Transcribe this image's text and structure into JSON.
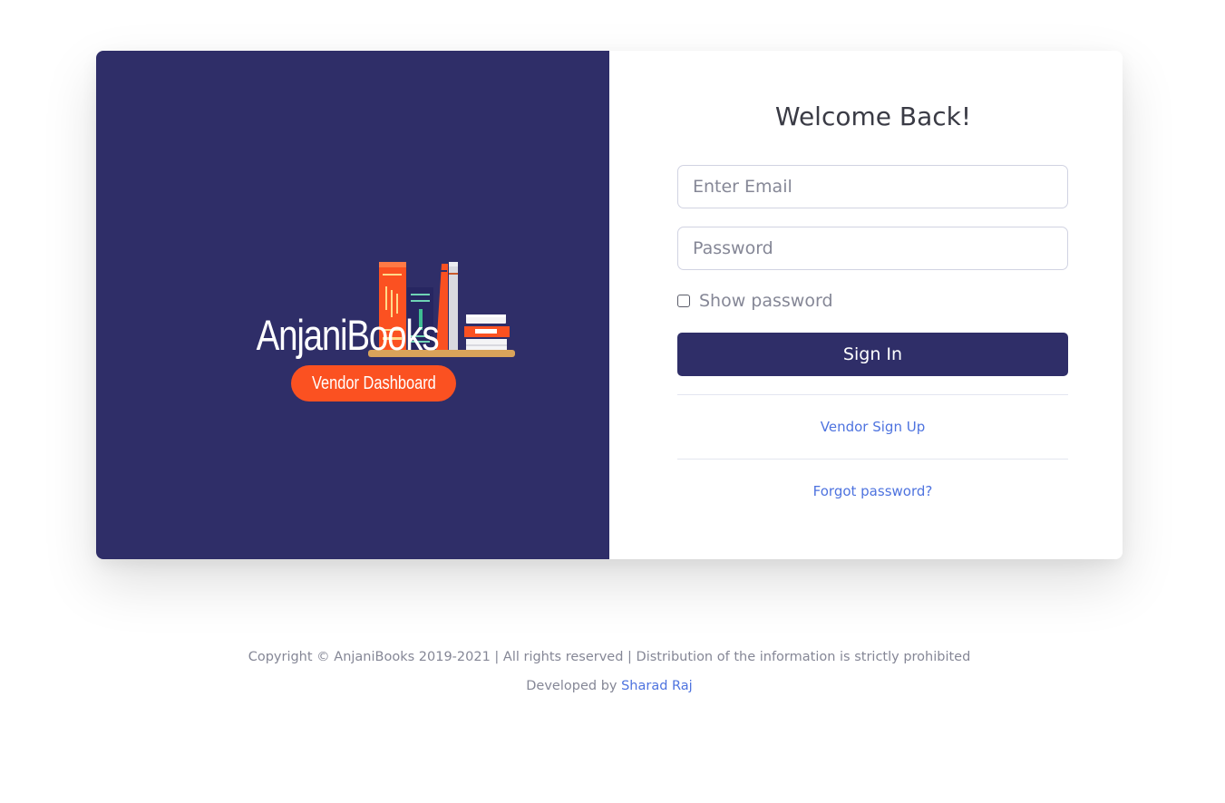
{
  "colors": {
    "brand_panel": "#2f2e68",
    "accent_orange": "#fb5121",
    "link": "#4e73df",
    "button": "#2f2e68"
  },
  "brand": {
    "logo_text": "AnjaniBooks",
    "tagline": "Vendor Dashboard",
    "illustration_icon": "books-on-shelf-icon"
  },
  "login": {
    "heading": "Welcome Back!",
    "email_placeholder": "Enter Email",
    "password_placeholder": "Password",
    "show_password_label": "Show password",
    "show_password_checked": false,
    "signin_label": "Sign In",
    "signup_link": "Vendor Sign Up",
    "forgot_link": "Forgot password?"
  },
  "footer": {
    "copyright": "Copyright © AnjaniBooks 2019-2021 | All rights reserved | Distribution of the information is strictly prohibited",
    "developed_by": "Developed by",
    "developer_name": "Sharad Raj"
  }
}
